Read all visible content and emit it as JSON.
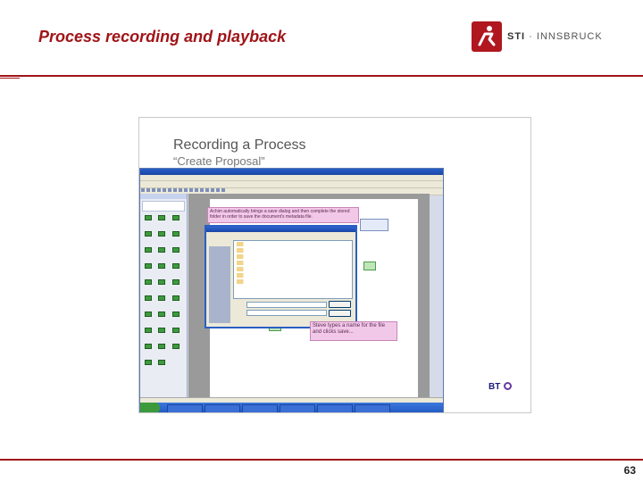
{
  "header": {
    "title": "Process recording and playback",
    "logo_brand": "STI",
    "logo_separator": " · ",
    "logo_location": "INNSBRUCK"
  },
  "colors": {
    "accent": "#a01418"
  },
  "screenshot": {
    "title": "Recording a Process",
    "subtitle": "“Create Proposal”",
    "callout_top": "Achim automatically brings a save dialog and then complete the stored folder in order to save the document's metadata file.",
    "callout_bottom": "Steve types a name for the file and clicks save...",
    "bt_logo": "BT"
  },
  "footer": {
    "page_number": "63"
  }
}
